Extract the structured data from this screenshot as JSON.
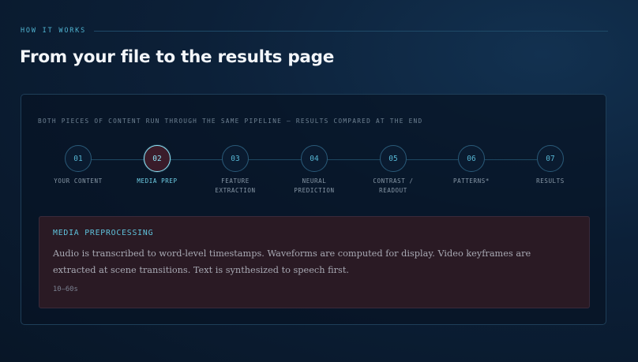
{
  "section": {
    "label": "HOW IT WORKS"
  },
  "page": {
    "title": "From your file to the results page"
  },
  "pipeline": {
    "caption": "BOTH PIECES OF CONTENT RUN THROUGH THE SAME PIPELINE — RESULTS COMPARED AT THE END",
    "active_step": 2,
    "steps": [
      {
        "number": "01",
        "label": "YOUR CONTENT"
      },
      {
        "number": "02",
        "label": "MEDIA PREP"
      },
      {
        "number": "03",
        "label": "FEATURE\nEXTRACTION"
      },
      {
        "number": "04",
        "label": "NEURAL\nPREDICTION"
      },
      {
        "number": "05",
        "label": "CONTRAST /\nREADOUT"
      },
      {
        "number": "06",
        "label": "PATTERNS*"
      },
      {
        "number": "07",
        "label": "RESULTS"
      }
    ]
  },
  "detail": {
    "title": "MEDIA PREPROCESSING",
    "body": "Audio is transcribed to word-level timestamps. Waveforms are computed for display. Video keyframes are extracted at scene transitions. Text is synthesized to speech first.",
    "duration": "10–60s"
  },
  "colors": {
    "accent": "#56b6d4",
    "active_ring": "#8ee3f5",
    "active_fill": "#3a1c2a",
    "card_bg": "#2a1a24"
  }
}
